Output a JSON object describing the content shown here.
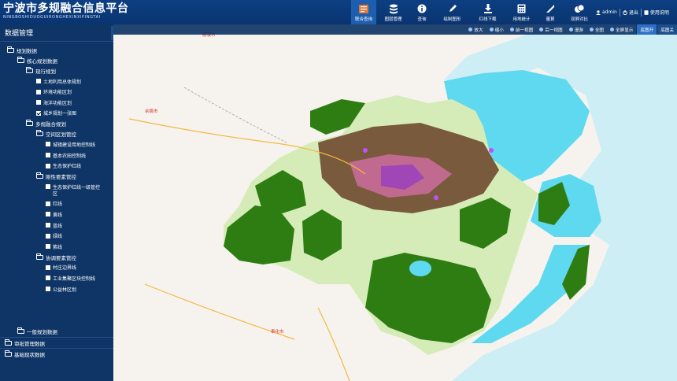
{
  "header": {
    "title": "宁波市多规融合信息平台",
    "subtitle": "NINGBOSHIDUOGUIRONGHEXINXIPINGTAI",
    "nav": [
      {
        "label": "联合查询",
        "icon": "query-book-icon",
        "active": true
      },
      {
        "label": "图层管理",
        "icon": "layers-icon",
        "active": false
      },
      {
        "label": "查询",
        "icon": "info-icon",
        "active": false
      },
      {
        "label": "绘制图形",
        "icon": "pencil-icon",
        "active": false
      },
      {
        "label": "红线下载",
        "icon": "download-icon",
        "active": false
      },
      {
        "label": "用地统计",
        "icon": "calculator-icon",
        "active": false
      },
      {
        "label": "量算",
        "icon": "ruler-icon",
        "active": false
      },
      {
        "label": "双屏对比",
        "icon": "compare-icon",
        "active": false
      }
    ],
    "user": {
      "name": "admin",
      "logout": "退出",
      "help": "使用说明"
    }
  },
  "sidebar": {
    "title": "数据管理",
    "tree": [
      {
        "label": "规划数据",
        "type": "folder",
        "level": 0
      },
      {
        "label": "核心规划数据",
        "type": "folder",
        "level": 1
      },
      {
        "label": "现行规划",
        "type": "folder",
        "level": 2
      },
      {
        "label": "土地利用总体规划",
        "type": "leaf",
        "level": 3,
        "checked": false
      },
      {
        "label": "环境功能区划",
        "type": "leaf",
        "level": 3,
        "checked": false
      },
      {
        "label": "海洋功能区划",
        "type": "leaf",
        "level": 3,
        "checked": false
      },
      {
        "label": "城乡规划一张图",
        "type": "leaf",
        "level": 3,
        "checked": true
      },
      {
        "label": "多规融合规划",
        "type": "folder",
        "level": 2
      },
      {
        "label": "空间区划管控",
        "type": "folder",
        "level": 3
      },
      {
        "label": "城镇建设用地控制线",
        "type": "leaf",
        "level": 4,
        "checked": false
      },
      {
        "label": "基本农田控制线",
        "type": "leaf",
        "level": 4,
        "checked": false
      },
      {
        "label": "生态保护红线",
        "type": "leaf",
        "level": 4,
        "checked": false
      },
      {
        "label": "刚性要素管控",
        "type": "folder",
        "level": 3
      },
      {
        "label": "生态保护红线一级管控",
        "type": "leaf",
        "level": 4,
        "checked": false,
        "wrap": "区"
      },
      {
        "label": "红线",
        "type": "leaf",
        "level": 4,
        "checked": false
      },
      {
        "label": "黄线",
        "type": "leaf",
        "level": 4,
        "checked": false
      },
      {
        "label": "蓝线",
        "type": "leaf",
        "level": 4,
        "checked": false
      },
      {
        "label": "绿线",
        "type": "leaf",
        "level": 4,
        "checked": false
      },
      {
        "label": "紫线",
        "type": "leaf",
        "level": 4,
        "checked": false
      },
      {
        "label": "协调要素管控",
        "type": "folder",
        "level": 3
      },
      {
        "label": "村庄边界线",
        "type": "leaf",
        "level": 4,
        "checked": false
      },
      {
        "label": "工业集聚区块控制线",
        "type": "leaf",
        "level": 4,
        "checked": false
      },
      {
        "label": "公益林区划",
        "type": "leaf",
        "level": 4,
        "checked": false
      },
      {
        "label": "一般规划数据",
        "type": "folder",
        "level": 1
      }
    ],
    "bottom": [
      "审批管理数据",
      "基础现状数据"
    ]
  },
  "toolbar": [
    {
      "label": "放大",
      "style": "tool"
    },
    {
      "label": "缩小",
      "style": "tool"
    },
    {
      "label": "前一视图",
      "style": "tool"
    },
    {
      "label": "后一视图",
      "style": "tool"
    },
    {
      "label": "漫游",
      "style": "tool"
    },
    {
      "label": "全图",
      "style": "tool"
    },
    {
      "label": "全屏显示",
      "style": "tool"
    },
    {
      "label": "底图开",
      "style": "btn"
    },
    {
      "label": "底图关",
      "style": "btn-dark"
    }
  ],
  "map": {
    "labels": [
      "慈溪市",
      "余姚市",
      "奉化市"
    ],
    "colors": {
      "green": "#2e7d12",
      "sea": "#5fd9f0",
      "sea_light": "#cdeef5",
      "light_green": "#d6ecb8"
    }
  }
}
